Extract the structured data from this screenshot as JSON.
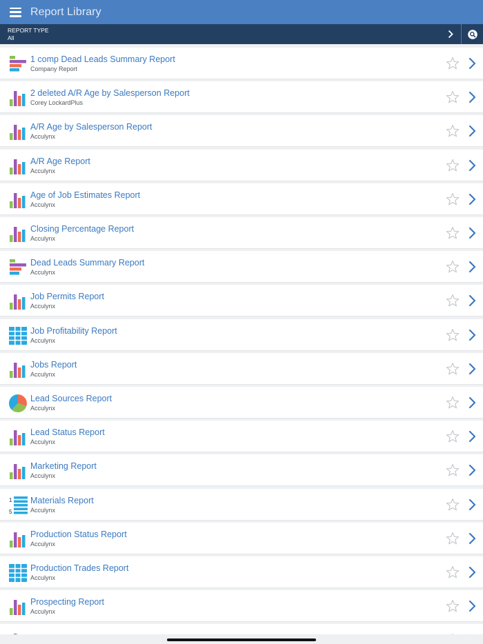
{
  "header": {
    "title": "Report Library"
  },
  "filter": {
    "label": "REPORT TYPE",
    "value": "All"
  },
  "icons": {
    "menu": "hamburger-icon",
    "filter_arrow": "chevron-right-icon",
    "search": "search-icon"
  },
  "colors": {
    "header": "#4b80c3",
    "filterbar": "#234063",
    "link": "#3b7ac0"
  },
  "reports": [
    {
      "name": "1 comp Dead Leads Summary Report",
      "source": "Company Report",
      "icon": "hbar"
    },
    {
      "name": "2 deleted A/R Age by Salesperson Report",
      "source": "Corey LockardPlus",
      "icon": "bar"
    },
    {
      "name": "A/R Age by Salesperson Report",
      "source": "Acculynx",
      "icon": "bar"
    },
    {
      "name": "A/R Age Report",
      "source": "Acculynx",
      "icon": "bar"
    },
    {
      "name": "Age of Job Estimates Report",
      "source": "Acculynx",
      "icon": "bar"
    },
    {
      "name": "Closing Percentage Report",
      "source": "Acculynx",
      "icon": "bar"
    },
    {
      "name": "Dead Leads Summary Report",
      "source": "Acculynx",
      "icon": "hbar"
    },
    {
      "name": "Job Permits Report",
      "source": "Acculynx",
      "icon": "bar"
    },
    {
      "name": "Job Profitability Report",
      "source": "Acculynx",
      "icon": "grid"
    },
    {
      "name": "Jobs Report",
      "source": "Acculynx",
      "icon": "bar"
    },
    {
      "name": "Lead Sources Report",
      "source": "Acculynx",
      "icon": "pie"
    },
    {
      "name": "Lead Status Report",
      "source": "Acculynx",
      "icon": "bar"
    },
    {
      "name": "Marketing Report",
      "source": "Acculynx",
      "icon": "bar"
    },
    {
      "name": "Materials Report",
      "source": "Acculynx",
      "icon": "list"
    },
    {
      "name": "Production Status Report",
      "source": "Acculynx",
      "icon": "bar"
    },
    {
      "name": "Production Trades Report",
      "source": "Acculynx",
      "icon": "grid"
    },
    {
      "name": "Prospecting Report",
      "source": "Acculynx",
      "icon": "bar"
    },
    {
      "name": "",
      "source": "",
      "icon": "bar"
    }
  ]
}
